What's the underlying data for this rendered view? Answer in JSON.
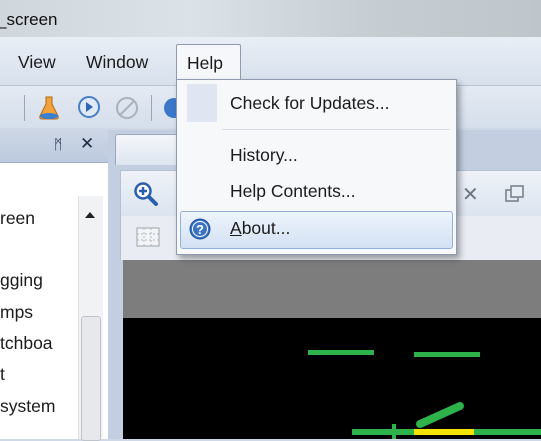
{
  "window": {
    "title_fragment": "_screen"
  },
  "menubar": {
    "items": [
      "View",
      "Window",
      "Help"
    ]
  },
  "help_menu": {
    "items": [
      {
        "label": "Check for Updates...",
        "icon": ""
      },
      {
        "label": "History...",
        "icon": ""
      },
      {
        "label": "Help Contents...",
        "icon": ""
      },
      {
        "label": "About...",
        "icon": "help-circle-icon",
        "highlighted": true,
        "mnemonic": "A"
      }
    ]
  },
  "left_panel": {
    "pin_glyph": "ᛗ",
    "close_glyph": "✕",
    "items": [
      "reen",
      "gging",
      "mps",
      "tchboa",
      "t",
      "system"
    ]
  },
  "colors": {
    "menu_highlight_border": "#93afd6",
    "canvas_background": "#000000",
    "canvas_line": "#2db34a",
    "canvas_highlight": "#f2e400"
  }
}
